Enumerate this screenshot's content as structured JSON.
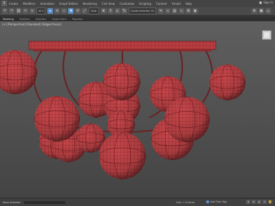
{
  "menubar": {
    "logo": "3",
    "items": [
      "Create",
      "Modifiers",
      "Animation",
      "Graph Editors",
      "Rendering",
      "Civil View",
      "Customize",
      "Scripting",
      "Content",
      "Arnold",
      "Help"
    ],
    "sign_in": "Sign In"
  },
  "toolbar": {
    "selection_dropdown": "Create Selection Se",
    "view_dropdown": "View"
  },
  "ribbon": {
    "tabs": [
      "Modeling",
      "Freeform",
      "Selection",
      "Object Paint",
      "Populate"
    ]
  },
  "viewport": {
    "label": "[+] [Perspective] [Standard] [Edged Faces]",
    "model": {
      "color": "#c8474b",
      "wire_color": "#5a1416",
      "top_bar_color": "#b83d41",
      "arm_color": "#6a2325"
    }
  },
  "statusbar": {
    "selection_text": "None Selected",
    "grid_text": "Grid = 10.0mm",
    "tag_text": "Add Time Tag"
  },
  "colors": {
    "accent": "#5b8fc9",
    "background": "#3a3a3a"
  }
}
